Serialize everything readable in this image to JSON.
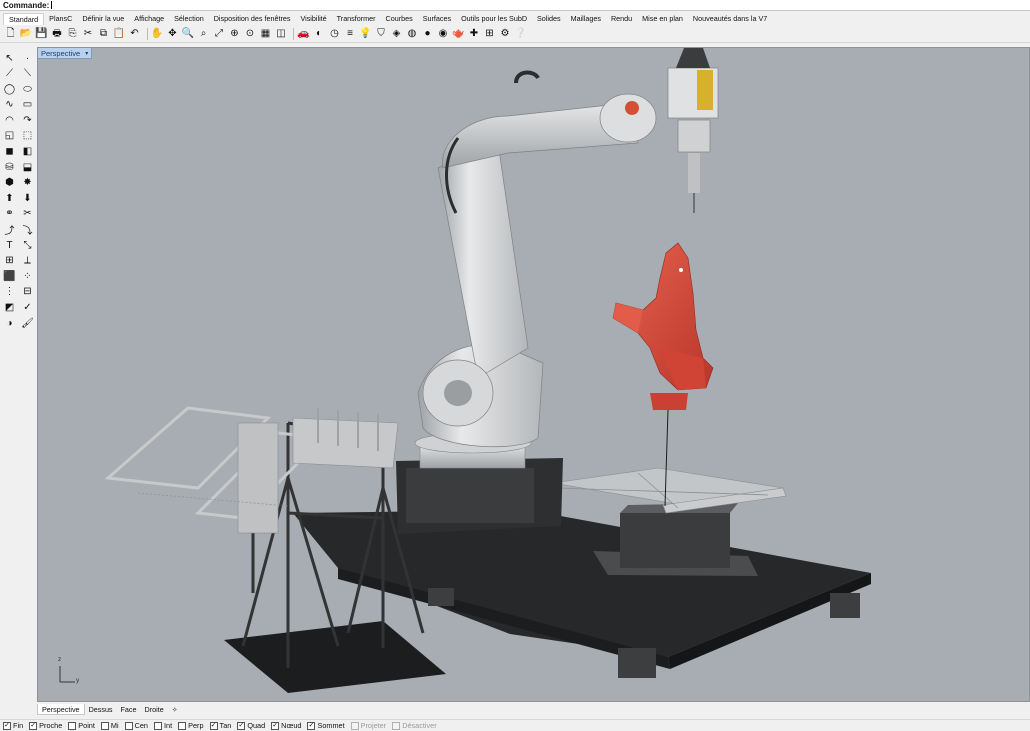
{
  "command": {
    "label": "Commande:"
  },
  "tabs": [
    {
      "label": "Standard",
      "active": true
    },
    {
      "label": "PlansC"
    },
    {
      "label": "Définir la vue"
    },
    {
      "label": "Affichage"
    },
    {
      "label": "Sélection"
    },
    {
      "label": "Disposition des fenêtres"
    },
    {
      "label": "Visibilité"
    },
    {
      "label": "Transformer"
    },
    {
      "label": "Courbes"
    },
    {
      "label": "Surfaces"
    },
    {
      "label": "Outils pour les SubD"
    },
    {
      "label": "Solides"
    },
    {
      "label": "Maillages"
    },
    {
      "label": "Rendu"
    },
    {
      "label": "Mise en plan"
    },
    {
      "label": "Nouveautés dans la V7"
    }
  ],
  "toolbar_icons": [
    {
      "name": "new-file-icon",
      "glyph": "🗋"
    },
    {
      "name": "open-folder-icon",
      "glyph": "📂"
    },
    {
      "name": "save-icon",
      "glyph": "💾"
    },
    {
      "name": "print-icon",
      "glyph": "🖶"
    },
    {
      "name": "import-icon",
      "glyph": "⎘"
    },
    {
      "name": "cut-icon",
      "glyph": "✂"
    },
    {
      "name": "copy-icon",
      "glyph": "⧉"
    },
    {
      "name": "paste-icon",
      "glyph": "📋"
    },
    {
      "name": "undo-icon",
      "glyph": "↶"
    },
    {
      "name": "pan-hand-icon",
      "glyph": "✋"
    },
    {
      "name": "rotate-view-icon",
      "glyph": "✥"
    },
    {
      "name": "zoom-icon",
      "glyph": "🔍"
    },
    {
      "name": "zoom-window-icon",
      "glyph": "⌕"
    },
    {
      "name": "zoom-extents-icon",
      "glyph": "⤢"
    },
    {
      "name": "zoom-selected-icon",
      "glyph": "⊕"
    },
    {
      "name": "zoom-target-icon",
      "glyph": "⊙"
    },
    {
      "name": "four-views-icon",
      "glyph": "▦"
    },
    {
      "name": "construction-plane-icon",
      "glyph": "◫"
    },
    {
      "name": "car-shaded-icon",
      "glyph": "🚗"
    },
    {
      "name": "set-view-icon",
      "glyph": "◐"
    },
    {
      "name": "clock-icon",
      "glyph": "◷"
    },
    {
      "name": "layer-icon",
      "glyph": "≡"
    },
    {
      "name": "lightbulb-icon",
      "glyph": "💡"
    },
    {
      "name": "select-filter-icon",
      "glyph": "⛉"
    },
    {
      "name": "material-icon",
      "glyph": "◈"
    },
    {
      "name": "color-wheel-icon",
      "glyph": "◍"
    },
    {
      "name": "sphere-render-icon",
      "glyph": "●"
    },
    {
      "name": "render-icon",
      "glyph": "◉"
    },
    {
      "name": "teapot-render-icon",
      "glyph": "🫖"
    },
    {
      "name": "gumball-icon",
      "glyph": "✚"
    },
    {
      "name": "grid-snap-icon",
      "glyph": "⊞"
    },
    {
      "name": "plugin-icon",
      "glyph": "⚙"
    },
    {
      "name": "help-icon",
      "glyph": "❔"
    }
  ],
  "sidebar_icons": [
    {
      "name": "select-arrow-icon",
      "glyph": "↖"
    },
    {
      "name": "point-icon",
      "glyph": "·"
    },
    {
      "name": "polyline-icon",
      "glyph": "⟋"
    },
    {
      "name": "line-icon",
      "glyph": "⟍"
    },
    {
      "name": "circle-icon",
      "glyph": "◯"
    },
    {
      "name": "ellipse-icon",
      "glyph": "⬭"
    },
    {
      "name": "curve-icon",
      "glyph": "∿"
    },
    {
      "name": "rectangle-icon",
      "glyph": "▭"
    },
    {
      "name": "arc-icon",
      "glyph": "◠"
    },
    {
      "name": "fillet-curve-icon",
      "glyph": "↷"
    },
    {
      "name": "surface-icon",
      "glyph": "◱"
    },
    {
      "name": "loft-icon",
      "glyph": "⬚"
    },
    {
      "name": "box-solid-icon",
      "glyph": "◼"
    },
    {
      "name": "boolean-icon",
      "glyph": "◧"
    },
    {
      "name": "cylinder-icon",
      "glyph": "⛁"
    },
    {
      "name": "pipe-icon",
      "glyph": "⬓"
    },
    {
      "name": "mesh-icon",
      "glyph": "⬢"
    },
    {
      "name": "explode-icon",
      "glyph": "✸"
    },
    {
      "name": "extrude-icon",
      "glyph": "⬆"
    },
    {
      "name": "split-icon",
      "glyph": "⬇"
    },
    {
      "name": "join-icon",
      "glyph": "⚭"
    },
    {
      "name": "trim-icon",
      "glyph": "✂"
    },
    {
      "name": "rebuild-icon",
      "glyph": "⤴"
    },
    {
      "name": "offset-icon",
      "glyph": "⤵"
    },
    {
      "name": "text-icon",
      "glyph": "T"
    },
    {
      "name": "scale-icon",
      "glyph": "⤡"
    },
    {
      "name": "move-icon",
      "glyph": "⊞"
    },
    {
      "name": "dimension-icon",
      "glyph": "⟂"
    },
    {
      "name": "block-icon",
      "glyph": "⬛"
    },
    {
      "name": "array-icon",
      "glyph": "⁘"
    },
    {
      "name": "dots-grid-icon",
      "glyph": "⋮"
    },
    {
      "name": "group-icon",
      "glyph": "⊟"
    },
    {
      "name": "analyze-icon",
      "glyph": "◩"
    },
    {
      "name": "check-icon",
      "glyph": "✓"
    },
    {
      "name": "render-settings-icon",
      "glyph": "◑"
    },
    {
      "name": "paint-icon",
      "glyph": "🖌"
    }
  ],
  "viewport": {
    "title": "Perspective",
    "dropdown": "▾"
  },
  "axis": {
    "z": "z",
    "y": "y"
  },
  "view_tabs": [
    {
      "label": "Perspective",
      "active": true
    },
    {
      "label": "Dessus"
    },
    {
      "label": "Face"
    },
    {
      "label": "Droite"
    },
    {
      "label": "✧"
    }
  ],
  "osnaps": [
    {
      "label": "Fin",
      "checked": true
    },
    {
      "label": "Proche",
      "checked": true
    },
    {
      "label": "Point",
      "checked": false
    },
    {
      "label": "Mi",
      "checked": false
    },
    {
      "label": "Cen",
      "checked": false
    },
    {
      "label": "Int",
      "checked": false
    },
    {
      "label": "Perp",
      "checked": false
    },
    {
      "label": "Tan",
      "checked": true
    },
    {
      "label": "Quad",
      "checked": true
    },
    {
      "label": "Nœud",
      "checked": true
    },
    {
      "label": "Sommet",
      "checked": true
    },
    {
      "label": "Projeter",
      "checked": false,
      "disabled": true
    },
    {
      "label": "Désactiver",
      "checked": false,
      "disabled": true
    }
  ],
  "colors": {
    "viewport_bg": "#a8adb3",
    "robot": "#d7d9db",
    "rooster": "#d9493a",
    "platform": "#232527",
    "frame": "#303234"
  }
}
